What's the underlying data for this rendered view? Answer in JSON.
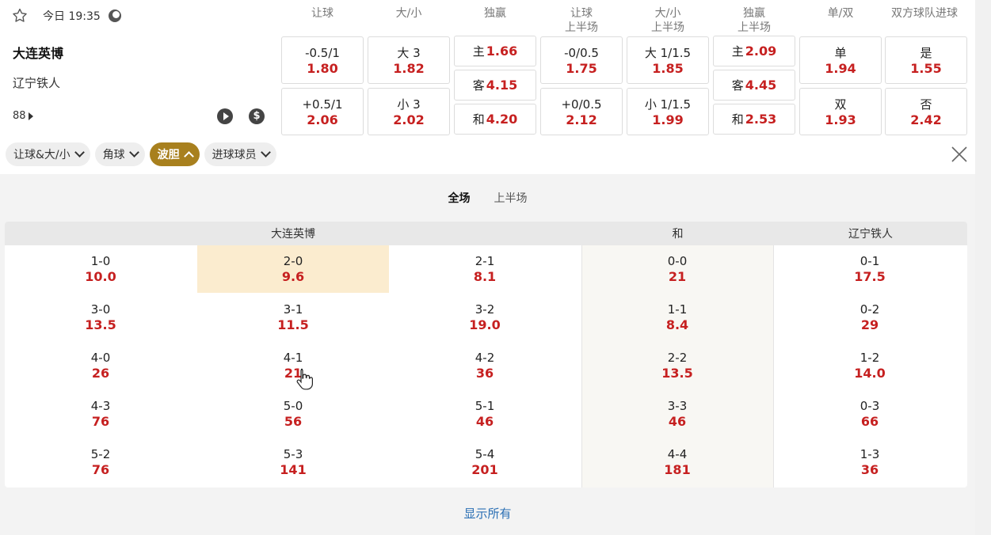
{
  "header": {
    "time": "今日 19:35",
    "columns": [
      "让球",
      "大/小",
      "独赢",
      "让球\n上半场",
      "大/小\n上半场",
      "独赢\n上半场",
      "单/双",
      "双方球队进球"
    ]
  },
  "match": {
    "home": "大连英博",
    "away": "辽宁铁人",
    "more_count": "88"
  },
  "odds": {
    "handicap": [
      {
        "label": "-0.5/1",
        "value": "1.80"
      },
      {
        "label": "+0.5/1",
        "value": "2.06"
      }
    ],
    "over_under": [
      {
        "label": "大 3",
        "value": "1.82"
      },
      {
        "label": "小 3",
        "value": "2.02"
      }
    ],
    "moneyline": [
      {
        "label": "主",
        "value": "1.66"
      },
      {
        "label": "客",
        "value": "4.15"
      },
      {
        "label": "和",
        "value": "4.20"
      }
    ],
    "handicap_1h": [
      {
        "label": "-0/0.5",
        "value": "1.75"
      },
      {
        "label": "+0/0.5",
        "value": "2.12"
      }
    ],
    "over_under_1h": [
      {
        "label": "大 1/1.5",
        "value": "1.85"
      },
      {
        "label": "小 1/1.5",
        "value": "1.99"
      }
    ],
    "moneyline_1h": [
      {
        "label": "主",
        "value": "2.09"
      },
      {
        "label": "客",
        "value": "4.45"
      },
      {
        "label": "和",
        "value": "2.53"
      }
    ],
    "odd_even": [
      {
        "label": "单",
        "value": "1.94"
      },
      {
        "label": "双",
        "value": "1.93"
      }
    ],
    "btts": [
      {
        "label": "是",
        "value": "1.55"
      },
      {
        "label": "否",
        "value": "2.42"
      }
    ]
  },
  "filters": [
    {
      "label": "让球&大/小",
      "active": false
    },
    {
      "label": "角球",
      "active": false
    },
    {
      "label": "波胆",
      "active": true
    },
    {
      "label": "进球球员",
      "active": false
    }
  ],
  "subtabs": [
    {
      "label": "全场",
      "active": true
    },
    {
      "label": "上半场",
      "active": false
    }
  ],
  "correct_score": {
    "headers": {
      "home": "大连英博",
      "draw": "和",
      "away": "辽宁铁人"
    },
    "rows": [
      [
        {
          "s": "1-0",
          "o": "10.0"
        },
        {
          "s": "2-0",
          "o": "9.6"
        },
        {
          "s": "2-1",
          "o": "8.1"
        },
        {
          "s": "0-0",
          "o": "21"
        },
        {
          "s": "0-1",
          "o": "17.5"
        }
      ],
      [
        {
          "s": "3-0",
          "o": "13.5"
        },
        {
          "s": "3-1",
          "o": "11.5"
        },
        {
          "s": "3-2",
          "o": "19.0"
        },
        {
          "s": "1-1",
          "o": "8.4"
        },
        {
          "s": "0-2",
          "o": "29"
        }
      ],
      [
        {
          "s": "4-0",
          "o": "26"
        },
        {
          "s": "4-1",
          "o": "21"
        },
        {
          "s": "4-2",
          "o": "36"
        },
        {
          "s": "2-2",
          "o": "13.5"
        },
        {
          "s": "1-2",
          "o": "14.0"
        }
      ],
      [
        {
          "s": "4-3",
          "o": "76"
        },
        {
          "s": "5-0",
          "o": "56"
        },
        {
          "s": "5-1",
          "o": "46"
        },
        {
          "s": "3-3",
          "o": "46"
        },
        {
          "s": "0-3",
          "o": "66"
        }
      ],
      [
        {
          "s": "5-2",
          "o": "76"
        },
        {
          "s": "5-3",
          "o": "141"
        },
        {
          "s": "5-4",
          "o": "201"
        },
        {
          "s": "4-4",
          "o": "181"
        },
        {
          "s": "1-3",
          "o": "36"
        }
      ]
    ]
  },
  "show_all": "显示所有",
  "colors": {
    "odds_red": "#c62020",
    "active_pill": "#a8801e",
    "highlight": "#fbeccf",
    "link_blue": "#2a6fb4"
  }
}
